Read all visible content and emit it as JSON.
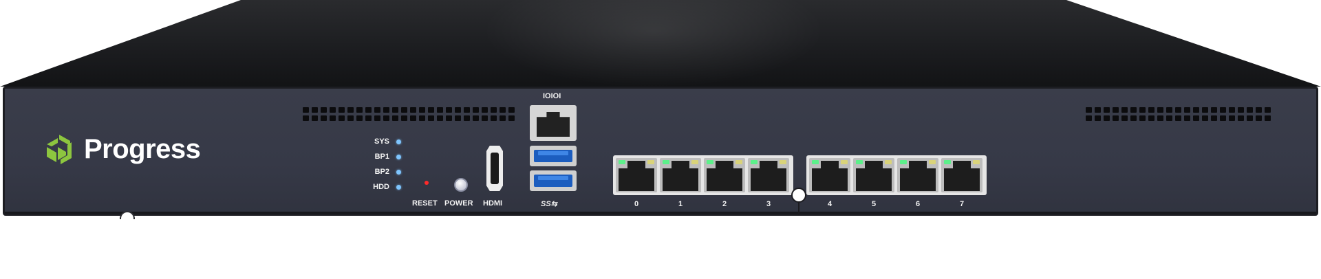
{
  "device": {
    "brand": "Progress",
    "icons": {
      "logo": "progress-logo-icon",
      "console": "console-port-icon",
      "usb": "usb3-icon"
    },
    "status_leds": [
      {
        "label": "SYS"
      },
      {
        "label": "BP1"
      },
      {
        "label": "BP2"
      },
      {
        "label": "HDD"
      }
    ],
    "controls": {
      "reset_label": "RESET",
      "power_label": "POWER",
      "hdmi_label": "HDMI"
    },
    "console_label": "IOIOI",
    "usb_label": "SS⇆",
    "ethernet_ports": [
      "0",
      "1",
      "2",
      "3",
      "4",
      "5",
      "6",
      "7"
    ],
    "colors": {
      "brand_green": "#8dc63f",
      "led_blue": "#7fc6ff",
      "reset_red": "#ff2a2a",
      "port_led_green": "#5cf08a",
      "port_led_amber": "#d9d37a",
      "panel": "#363947"
    }
  }
}
